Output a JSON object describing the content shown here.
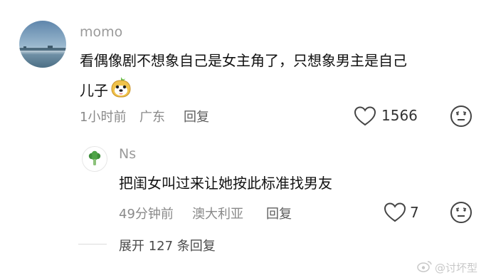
{
  "comment": {
    "username": "momo",
    "text_line1": "看偶像剧不想象自己是女主角了，只想象男主是自己",
    "text_line2": "儿子",
    "time": "1小时前",
    "location": "广东",
    "reply_label": "回复",
    "likes": "1566"
  },
  "reply": {
    "username": "Ns",
    "text": "把闺女叫过来让她按此标准找男友",
    "time": "49分钟前",
    "location": "澳大利亚",
    "reply_label": "回复",
    "likes": "7"
  },
  "expand": {
    "label": "展开 127 条回复"
  },
  "watermark": {
    "text": "@讨坏型"
  },
  "colors": {
    "text": "#111111",
    "meta": "#8a8a8a",
    "username": "#9a9a9a"
  }
}
